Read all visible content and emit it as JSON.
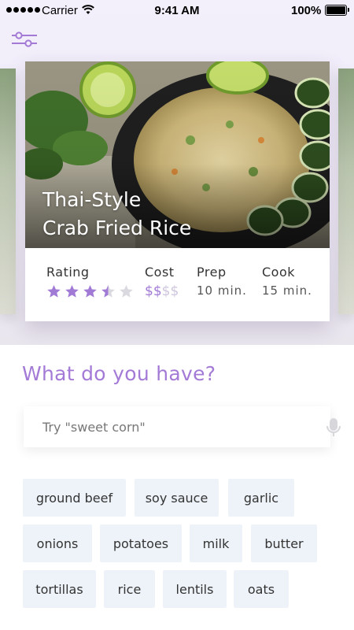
{
  "status_bar": {
    "carrier": "Carrier",
    "time": "9:41 AM",
    "battery": "100%"
  },
  "header": {
    "filter_icon": "sliders-icon"
  },
  "featured_recipe": {
    "title_line1": "Thai-Style",
    "title_line2": "Crab Fried Rice",
    "rating_label": "Rating",
    "rating": 3.5,
    "rating_max": 5,
    "cost_label": "Cost",
    "cost_level": 2,
    "cost_max": 4,
    "cost_symbol": "$",
    "prep_label": "Prep",
    "prep_value": "10 min.",
    "cook_label": "Cook",
    "cook_value": "15 min."
  },
  "pantry": {
    "question": "What do you have?",
    "search_placeholder": "Try \"sweet corn\"",
    "mic_icon": "microphone-icon",
    "ingredients": [
      "ground beef",
      "soy sauce",
      "garlic",
      "onions",
      "potatoes",
      "milk",
      "butter",
      "tortillas",
      "rice",
      "lentils",
      "oats"
    ]
  },
  "colors": {
    "accent": "#a47ad7",
    "star_on": "#a17ad6",
    "star_off": "#d9d9df",
    "chip_bg": "#eef3f9"
  }
}
